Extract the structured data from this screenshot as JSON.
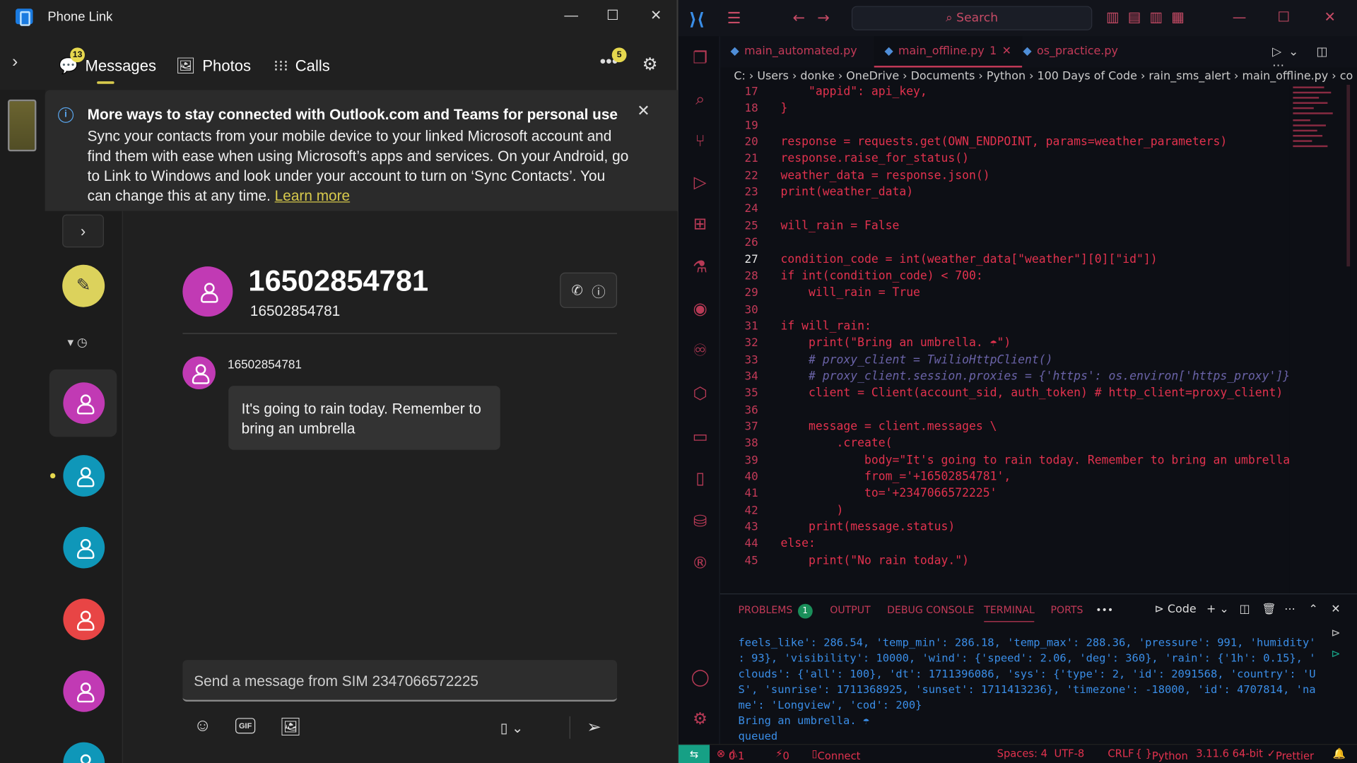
{
  "phonelink": {
    "title": "Phone Link",
    "tabs": [
      "Messages",
      "Photos",
      "Calls"
    ],
    "messages_badge": "13",
    "more_badge": "5",
    "banner": {
      "title": "More ways to stay connected with Outlook.com and Teams for personal use",
      "body": "Sync your contacts from your mobile device to your linked Microsoft account and find them with ease when using Microsoft’s apps and services. On your Android, go to Link to Windows and look under your account to turn on ‘Sync Contacts’. You can change this at any time.",
      "link": "Learn more"
    },
    "avatar_colors": [
      "#c13ab4",
      "#0f97b9",
      "#0f97b9",
      "#e84545",
      "#c13ab4",
      "#0f97b9"
    ],
    "conversation": {
      "name": "16502854781",
      "number": "16502854781",
      "sender": "16502854781",
      "message": "It's going to rain today. Remember to bring an umbrella"
    },
    "input_placeholder": "Send a message from SIM 2347066572225",
    "gif_label": "GIF"
  },
  "vscode": {
    "search": "Search",
    "tabs": [
      {
        "label": "main_automated.py",
        "badge": ""
      },
      {
        "label": "main_offline.py",
        "badge": "1"
      },
      {
        "label": "os_practice.py",
        "badge": ""
      }
    ],
    "breadcrumb": "C: › Users › donke › OneDrive › Documents › Python › 100 Days of Code › rain_sms_alert › main_offline.py › co",
    "line_numbers": [
      "17",
      "18",
      "19",
      "20",
      "21",
      "22",
      "23",
      "24",
      "25",
      "26",
      "27",
      "28",
      "29",
      "30",
      "31",
      "32",
      "33",
      "34",
      "35",
      "36",
      "37",
      "38",
      "39",
      "40",
      "41",
      "42",
      "43",
      "44",
      "45"
    ],
    "current_line": "27",
    "code_lines": [
      "    \"appid\": api_key,",
      "}",
      "",
      "response = requests.get(OWN_ENDPOINT, params=weather_parameters)",
      "response.raise_for_status()",
      "weather_data = response.json()",
      "print(weather_data)",
      "",
      "will_rain = False",
      "",
      "condition_code = int(weather_data[\"weather\"][0][\"id\"])",
      "if int(condition_code) < 700:",
      "    will_rain = True",
      "",
      "if will_rain:",
      "    print(\"Bring an umbrella. ☂\")",
      "    # proxy_client = TwilioHttpClient()",
      "    # proxy_client.session.proxies = {'https': os.environ['https_proxy']}",
      "    client = Client(account_sid, auth_token) # http_client=proxy_client)",
      "",
      "    message = client.messages \\",
      "        .create(",
      "            body=\"It's going to rain today. Remember to bring an umbrella.",
      "            from_='+16502854781',",
      "            to='+2347066572225'",
      "        )",
      "    print(message.status)",
      "else:",
      "    print(\"No rain today.\")"
    ],
    "panel_tabs": [
      "PROBLEMS",
      "OUTPUT",
      "DEBUG CONSOLE",
      "TERMINAL",
      "PORTS"
    ],
    "problems_count": "1",
    "terminal_profile": "Code",
    "terminal_lines": [
      "feels_like': 286.54, 'temp_min': 286.18, 'temp_max': 288.36, 'pressure': 991, 'humidity'",
      ": 93}, 'visibility': 10000, 'wind': {'speed': 2.06, 'deg': 360}, 'rain': {'1h': 0.15}, '",
      "clouds': {'all': 100}, 'dt': 1711396086, 'sys': {'type': 2, 'id': 2091568, 'country': 'U",
      "S', 'sunrise': 1711368925, 'sunset': 1711413236}, 'timezone': -18000, 'id': 4707814, 'na",
      "me': 'Longview', 'cod': 200}",
      "Bring an umbrella. ☂",
      "queued"
    ],
    "status": {
      "errors": "0",
      "warnings": "1",
      "ports": "0",
      "connect": "Connect",
      "spaces": "Spaces: 4",
      "encoding": "UTF-8",
      "eol": "CRLF",
      "language": "Python",
      "version": "3.11.6 64-bit",
      "formatter": "Prettier"
    }
  }
}
